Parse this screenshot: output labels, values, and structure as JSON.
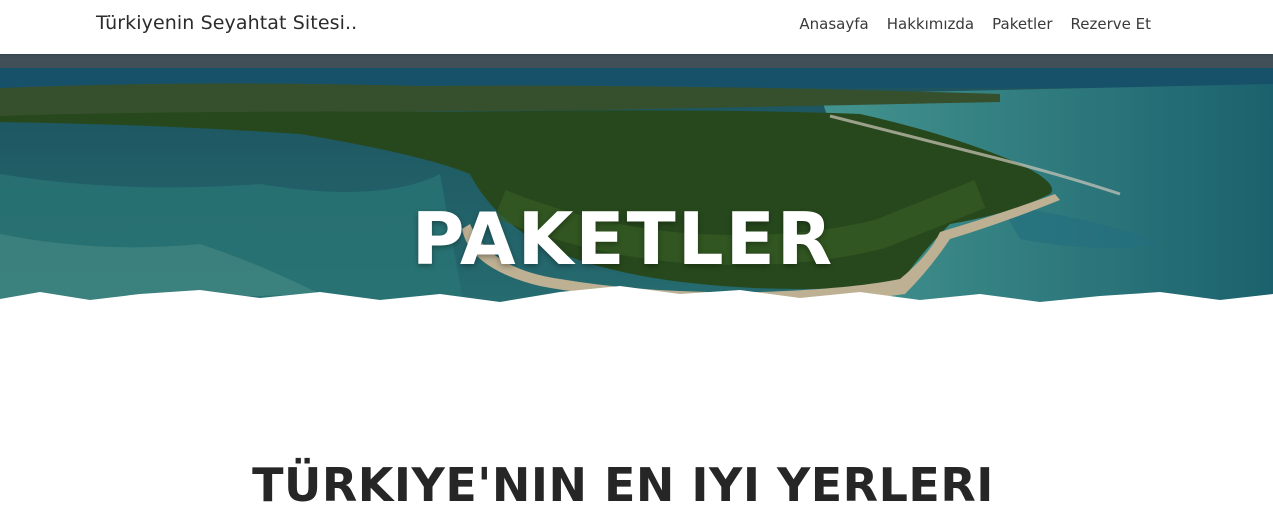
{
  "navbar": {
    "brand": "Türkiyenin Seyahtat Sitesi..",
    "links": [
      "Anasayfa",
      "Hakkımızda",
      "Paketler",
      "Rezerve Et"
    ]
  },
  "hero": {
    "title": "PAKETLER",
    "image": "aerial-island-beach"
  },
  "section": {
    "title": "TÜRKIYE'NIN EN IYI YERLERI"
  },
  "colors": {
    "sea": "#1b6a72",
    "shallow": "#4fa6a0",
    "forest": "#2f5a22",
    "sand": "#d8c9a8",
    "text": "#262626"
  }
}
